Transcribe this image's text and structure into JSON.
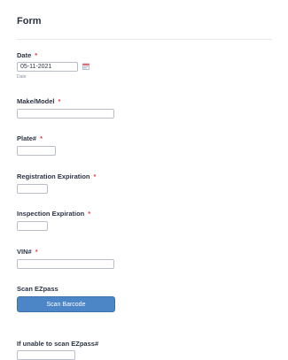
{
  "form": {
    "title": "Form",
    "date": {
      "label": "Date",
      "required": "*",
      "value": "05-11-2021",
      "sublabel": "Date",
      "icon": "calendar-icon"
    },
    "make_model": {
      "label": "Make/Model",
      "required": "*",
      "value": ""
    },
    "plate": {
      "label": "Plate#",
      "required": "*",
      "value": ""
    },
    "registration_expiration": {
      "label": "Registration Expiration",
      "required": "*",
      "value": ""
    },
    "inspection_expiration": {
      "label": "Inspection Expiration",
      "required": "*",
      "value": ""
    },
    "vin": {
      "label": "VIN#",
      "required": "*",
      "value": ""
    },
    "scan_ezpass": {
      "label": "Scan EZpass",
      "button_label": "Scan Barcode"
    },
    "ezpass_manual": {
      "label": "If unable to scan EZpass#",
      "value": ""
    }
  },
  "colors": {
    "required": "#f23a3c",
    "button": "#4c86c6",
    "text": "#2c3345",
    "border": "#b8bdc9"
  }
}
